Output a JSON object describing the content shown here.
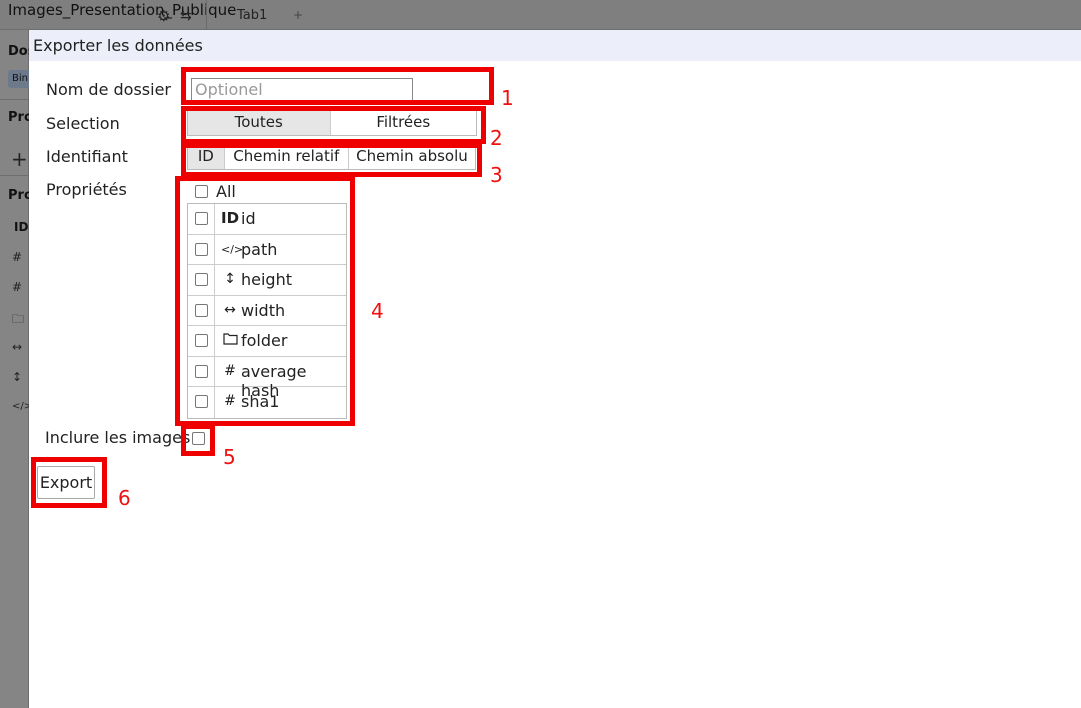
{
  "app": {
    "title": "Images_Presentation_Publique",
    "tab_label": "Tab1",
    "add_tab_label": "+",
    "sidebar": {
      "section1": "Dossiers",
      "chip": "Bin",
      "section2": "Propriétés",
      "section3": "Propriétés",
      "id_label": "ID"
    }
  },
  "modal": {
    "title": "Exporter les données",
    "folder": {
      "label": "Nom de dossier",
      "placeholder": "Optionel",
      "value": ""
    },
    "selection": {
      "label": "Selection",
      "options": [
        "Toutes",
        "Filtrées"
      ],
      "selected": "Toutes"
    },
    "identifier": {
      "label": "Identifiant",
      "options": [
        "ID",
        "Chemin relatif",
        "Chemin absolu"
      ],
      "selected": "ID"
    },
    "properties": {
      "label": "Propriétés",
      "all_label": "All",
      "items": [
        {
          "icon": "ID",
          "name": "id"
        },
        {
          "icon": "</>",
          "name": "path"
        },
        {
          "icon": "↕",
          "name": "height"
        },
        {
          "icon": "↔",
          "name": "width"
        },
        {
          "icon": "folder",
          "name": "folder"
        },
        {
          "icon": "#",
          "name": "average hash"
        },
        {
          "icon": "#",
          "name": "sha1"
        }
      ]
    },
    "include_images": {
      "label": "Inclure les images",
      "checked": false
    },
    "export_label": "Export"
  },
  "annotations": [
    "1",
    "2",
    "3",
    "4",
    "5",
    "6"
  ],
  "colors": {
    "annotation_red": "#ee0000",
    "header_bg": "#eceff9"
  }
}
